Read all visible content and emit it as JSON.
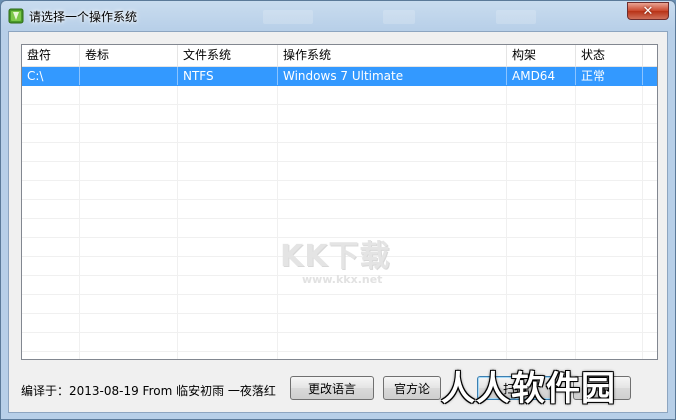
{
  "window": {
    "title": "请选择一个操作系统",
    "close_glyph": "✕"
  },
  "listview": {
    "columns": [
      "盘符",
      "卷标",
      "文件系统",
      "操作系统",
      "构架",
      "状态"
    ],
    "rows": [
      {
        "drive": "C:\\",
        "label": "",
        "filesystem": "NTFS",
        "os": "Windows 7 Ultimate",
        "arch": "AMD64",
        "status": "正常",
        "selected": true
      }
    ]
  },
  "watermark": {
    "logo": "KK下载",
    "url": "www.kkx.net"
  },
  "footer": {
    "compile_info": "编译于：2013-08-19 From 临安初雨 一夜落红",
    "buttons": {
      "change_language": "更改语言",
      "official": "官方论",
      "third": "扫描",
      "fourth": "导"
    }
  },
  "corner_logo": "人人软件园",
  "colors": {
    "selection": "#3399ff",
    "close_button": "#c9462c",
    "titlebar": "#c9dcef"
  }
}
